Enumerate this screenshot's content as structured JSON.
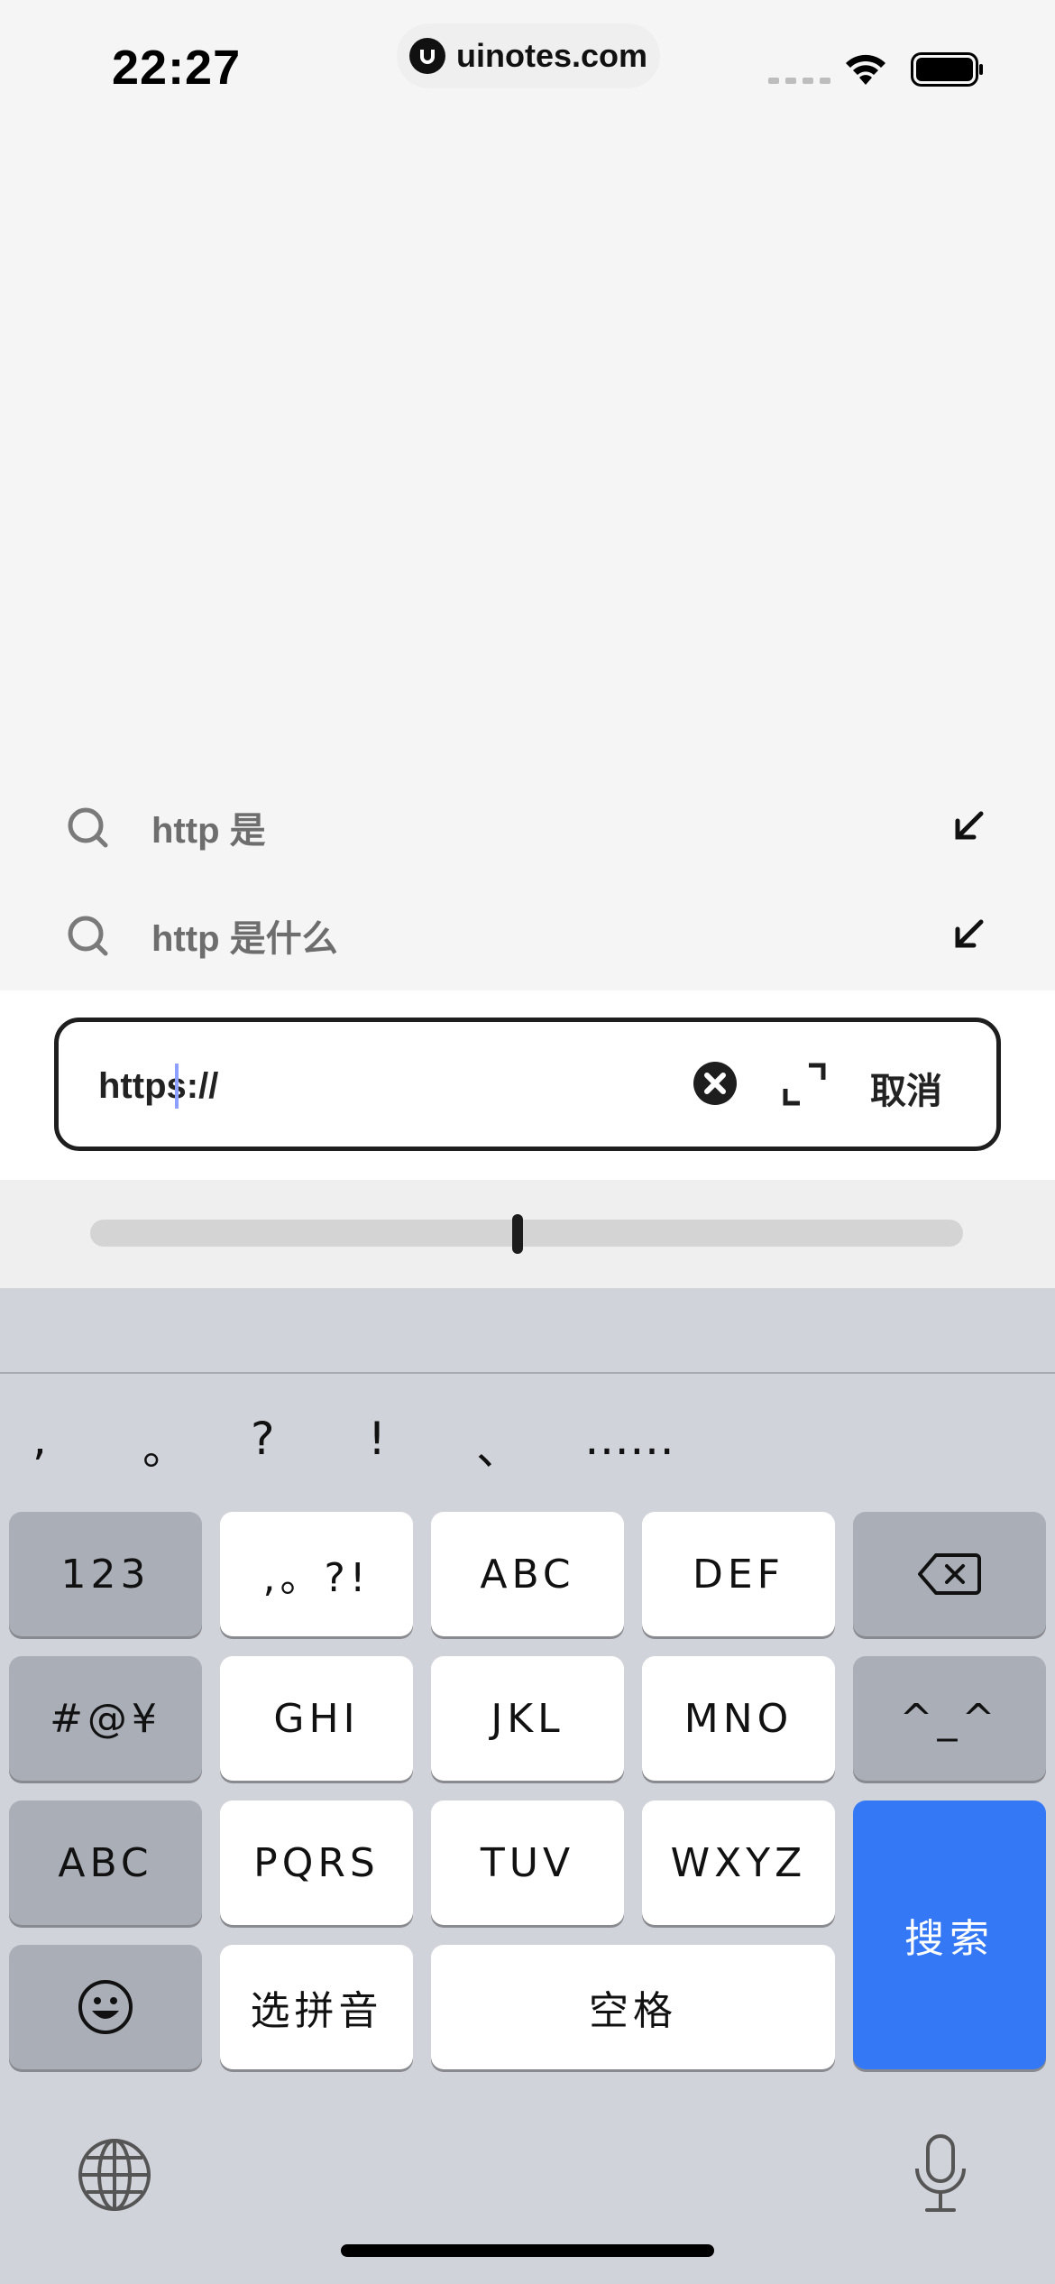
{
  "status_bar": {
    "time": "22:27",
    "url": "uinotes.com"
  },
  "suggestions": [
    {
      "text": "http 是",
      "icon": "search-icon",
      "action_icon": "fill-arrow-icon"
    },
    {
      "text": "http 是什么",
      "icon": "search-icon",
      "action_icon": "fill-arrow-icon"
    }
  ],
  "search": {
    "value": "https://",
    "cancel_label": "取消"
  },
  "slider": {
    "position_fraction": 0.49
  },
  "keyboard": {
    "punctuation": [
      ",",
      "。",
      "?",
      "!",
      "、",
      "……"
    ],
    "keys": {
      "num": "123",
      "punct_key": ",。?!",
      "abc_top": "ABC",
      "def": "DEF",
      "symbols": "#@¥",
      "ghi": "GHI",
      "jkl": "JKL",
      "mno": "MNO",
      "emoticon": "^_^",
      "abc_mode": "ABC",
      "pqrs": "PQRS",
      "tuv": "TUV",
      "wxyz": "WXYZ",
      "search": "搜索",
      "pinyin": "选拼音",
      "space": "空格"
    },
    "search_key_color": "#3478f6"
  }
}
